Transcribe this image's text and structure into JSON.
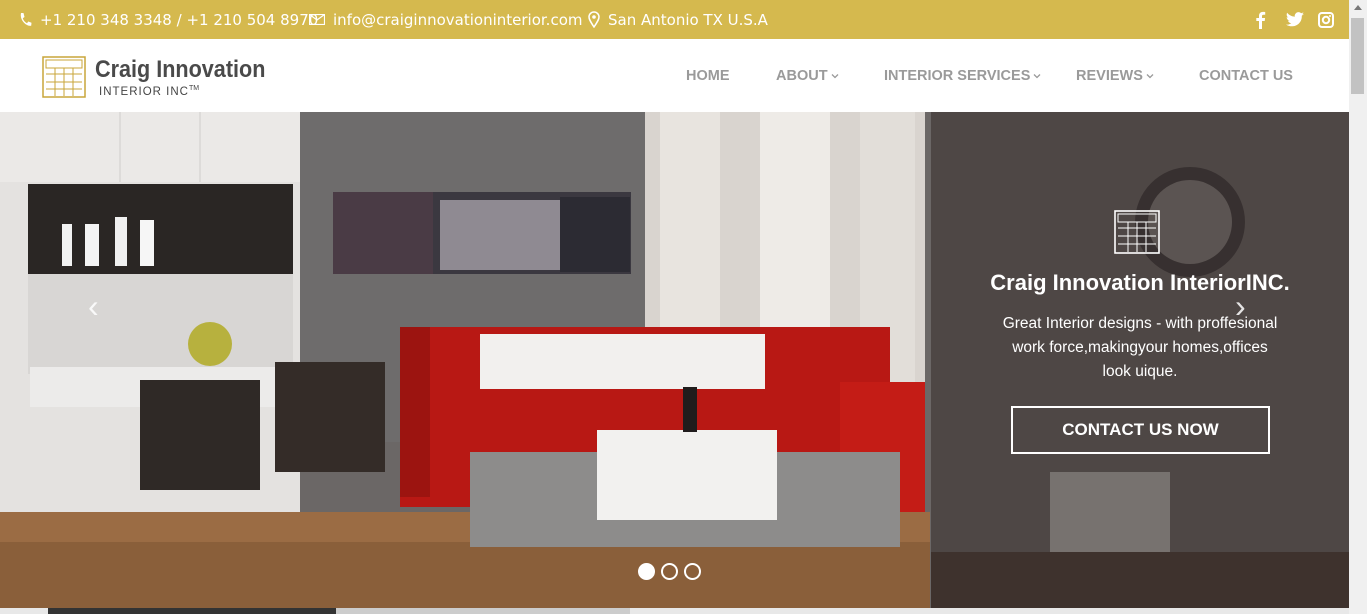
{
  "topbar": {
    "phone": "+1 210 348 3348 / +1 210 504 8970",
    "email": "info@craiginnovationinterior.com",
    "location": "San Antonio TX U.S.A",
    "icons": [
      "phone-icon",
      "mail-icon",
      "location-pin-icon",
      "facebook-icon",
      "twitter-icon",
      "instagram-icon"
    ],
    "color": "#d5b94e"
  },
  "logo": {
    "name": "Craig Innovation",
    "sub": "INTERIOR INC",
    "tm": "TM"
  },
  "nav": {
    "items": [
      {
        "label": "HOME",
        "dropdown": false
      },
      {
        "label": "ABOUT",
        "dropdown": true
      },
      {
        "label": "INTERIOR SERVICES",
        "dropdown": true
      },
      {
        "label": "REVIEWS",
        "dropdown": true
      },
      {
        "label": "CONTACT US",
        "dropdown": false
      }
    ]
  },
  "hero": {
    "title": "Craig Innovation InteriorINC.",
    "line1": "Great Interior designs - with proffesional",
    "line2": "work force,makingyour homes,offices",
    "line3": "look uique.",
    "button": "CONTACT US NOW",
    "prev": "‹",
    "next": "›",
    "slides": 3,
    "active_slide": 1
  }
}
